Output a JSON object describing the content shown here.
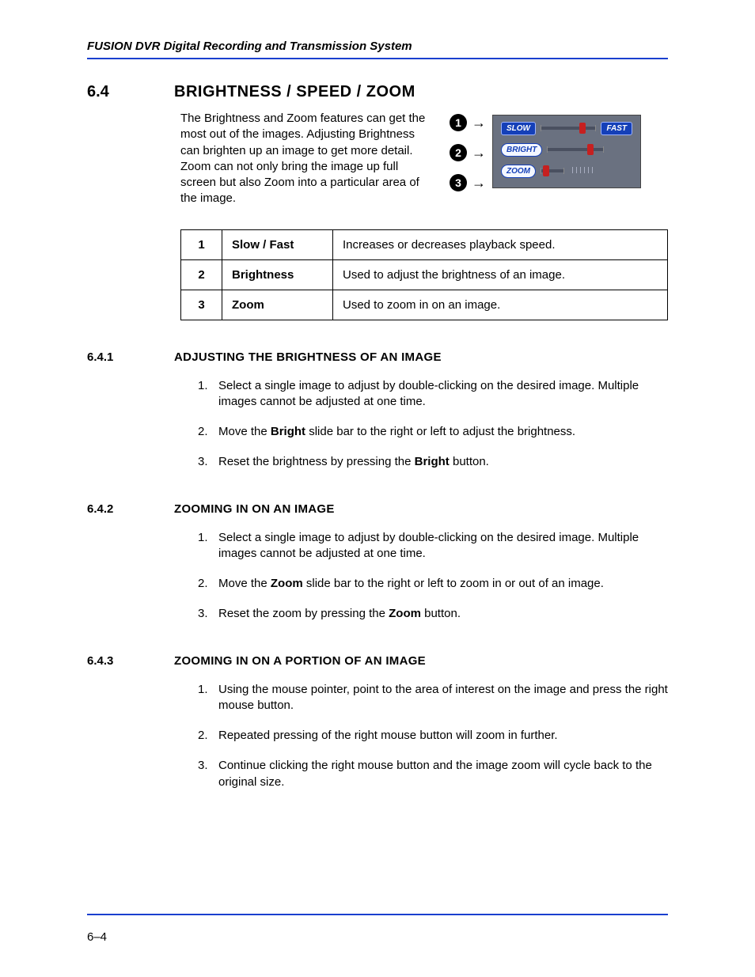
{
  "header": {
    "doc_title": "FUSION DVR Digital Recording and Transmission System"
  },
  "section": {
    "number": "6.4",
    "title": "BRIGHTNESS / SPEED / ZOOM",
    "intro": "The Brightness and Zoom features can get the most out of the images. Adjusting Brightness can brighten up an image to get more detail. Zoom can not only bring the image up full screen but also Zoom into a particular area of the image."
  },
  "panel": {
    "callouts": [
      "1",
      "2",
      "3"
    ],
    "slow": "SLOW",
    "fast": "FAST",
    "bright": "BRIGHT",
    "zoom": "ZOOM"
  },
  "feature_table": [
    {
      "num": "1",
      "name": "Slow / Fast",
      "desc": "Increases or decreases playback speed."
    },
    {
      "num": "2",
      "name": "Brightness",
      "desc": "Used to adjust the brightness of an image."
    },
    {
      "num": "3",
      "name": "Zoom",
      "desc": "Used to zoom in on an image."
    }
  ],
  "subsections": [
    {
      "number": "6.4.1",
      "title": "ADJUSTING THE BRIGHTNESS OF AN IMAGE",
      "steps": [
        [
          {
            "t": "Select a single image to adjust by double-clicking on the desired image. Multiple images cannot be adjusted at one time."
          }
        ],
        [
          {
            "t": "Move the "
          },
          {
            "t": "Bright",
            "b": true
          },
          {
            "t": " slide bar to the right or left to adjust the brightness."
          }
        ],
        [
          {
            "t": "Reset the brightness by pressing the "
          },
          {
            "t": "Bright",
            "b": true
          },
          {
            "t": " button."
          }
        ]
      ]
    },
    {
      "number": "6.4.2",
      "title": "ZOOMING IN ON AN IMAGE",
      "steps": [
        [
          {
            "t": "Select a single image to adjust by double-clicking on the desired image. Multiple images cannot be adjusted at one time."
          }
        ],
        [
          {
            "t": "Move the "
          },
          {
            "t": "Zoom",
            "b": true
          },
          {
            "t": " slide bar to the right or left to zoom in or out of an image."
          }
        ],
        [
          {
            "t": "Reset the zoom by pressing the "
          },
          {
            "t": "Zoom",
            "b": true
          },
          {
            "t": " button."
          }
        ]
      ]
    },
    {
      "number": "6.4.3",
      "title": "ZOOMING IN ON A PORTION OF AN IMAGE",
      "steps": [
        [
          {
            "t": "Using the mouse pointer, point to the area of interest on the image and press the right mouse button."
          }
        ],
        [
          {
            "t": "Repeated pressing of the right mouse button will zoom in further."
          }
        ],
        [
          {
            "t": "Continue clicking the right mouse button and the image zoom will cycle back to the original size."
          }
        ]
      ]
    }
  ],
  "footer": {
    "page_num": "6–4"
  }
}
